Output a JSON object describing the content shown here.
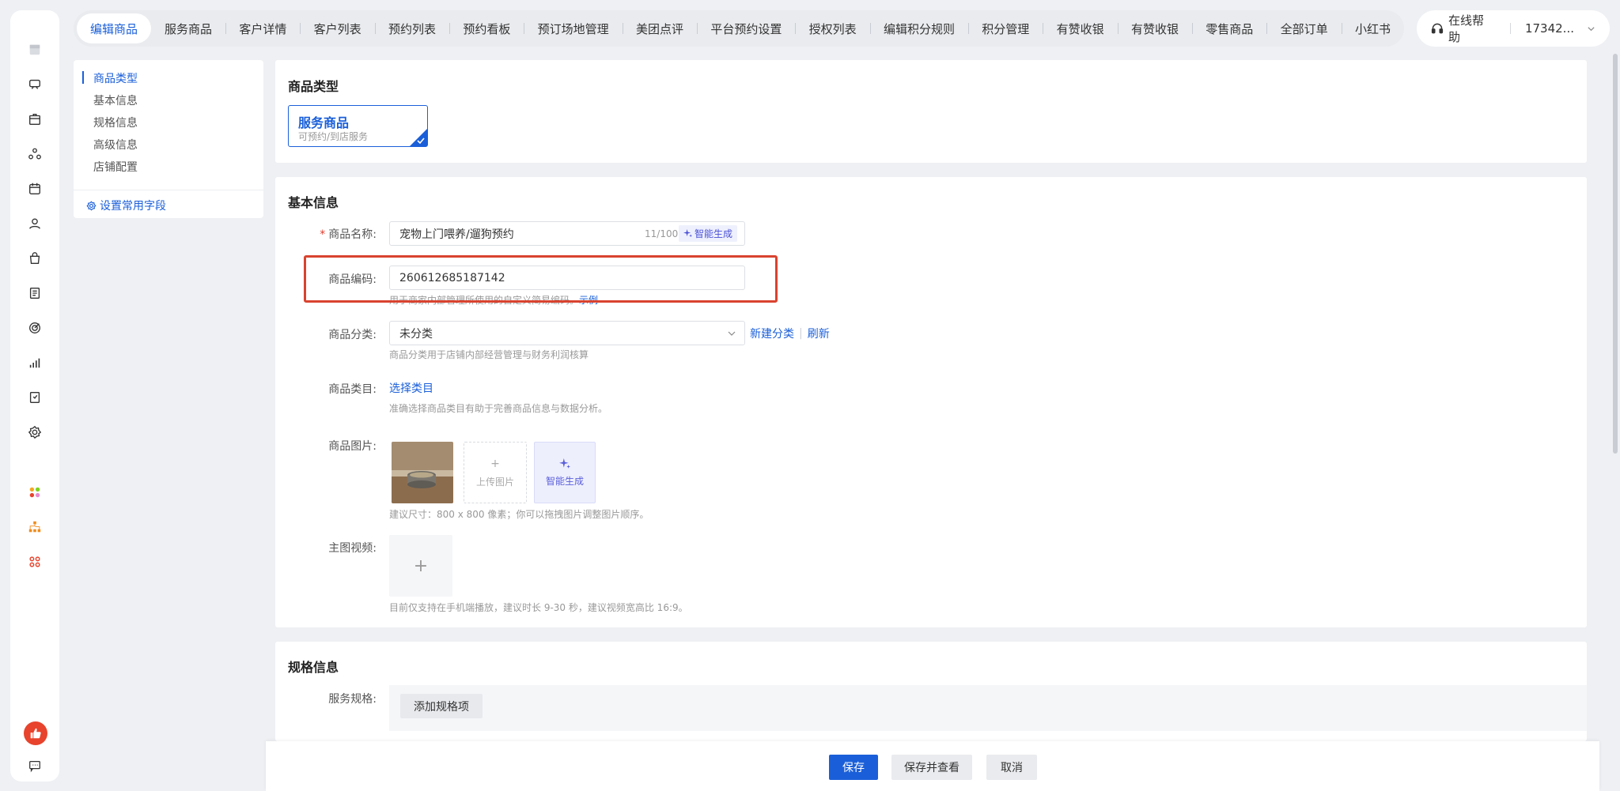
{
  "top_tabs": [
    "编辑商品",
    "服务商品",
    "客户详情",
    "客户列表",
    "预约列表",
    "预约看板",
    "预订场地管理",
    "美团点评",
    "平台预约设置",
    "授权列表",
    "编辑积分规则",
    "积分管理",
    "有赞收银",
    "有赞收银",
    "零售商品",
    "全部订单",
    "小红书"
  ],
  "topright": {
    "help": "在线帮助",
    "user": "17342..."
  },
  "section_nav": {
    "items": [
      "商品类型",
      "基本信息",
      "规格信息",
      "高级信息",
      "店铺配置"
    ],
    "config_link": "设置常用字段"
  },
  "product_type": {
    "title": "商品类型",
    "option_title": "服务商品",
    "option_desc": "可预约/到店服务"
  },
  "basic": {
    "title": "基本信息",
    "name_label": "商品名称:",
    "name_value": "宠物上门喂养/遛狗预约",
    "name_counter": "11/100",
    "ai_generate": "智能生成",
    "code_label": "商品编码:",
    "code_value": "260612685187142",
    "code_hint": "用于商家内部管理所使用的自定义简易编码。",
    "code_hint_link": "示例",
    "category_label": "商品分类:",
    "category_value": "未分类",
    "new_category": "新建分类",
    "refresh": "刷新",
    "category_hint": "商品分类用于店铺内部经营管理与财务利润核算",
    "class_label": "商品类目:",
    "class_link": "选择类目",
    "class_hint": "准确选择商品类目有助于完善商品信息与数据分析。",
    "image_label": "商品图片:",
    "upload_label": "上传图片",
    "ai_image": "智能生成",
    "image_hint": "建议尺寸：800 x 800 像素；你可以拖拽图片调整图片顺序。",
    "video_label": "主图视频:",
    "video_hint": "目前仅支持在手机端播放，建议时长 9-30 秒，建议视频宽高比 16:9。"
  },
  "spec": {
    "title": "规格信息",
    "service_spec_label": "服务规格:",
    "add_spec": "添加规格项"
  },
  "footer": {
    "save": "保存",
    "save_view": "保存并查看",
    "cancel": "取消"
  },
  "colors": {
    "accent": "#1a5fd9",
    "highlight": "#d9432f",
    "brand": "#e8432c"
  }
}
